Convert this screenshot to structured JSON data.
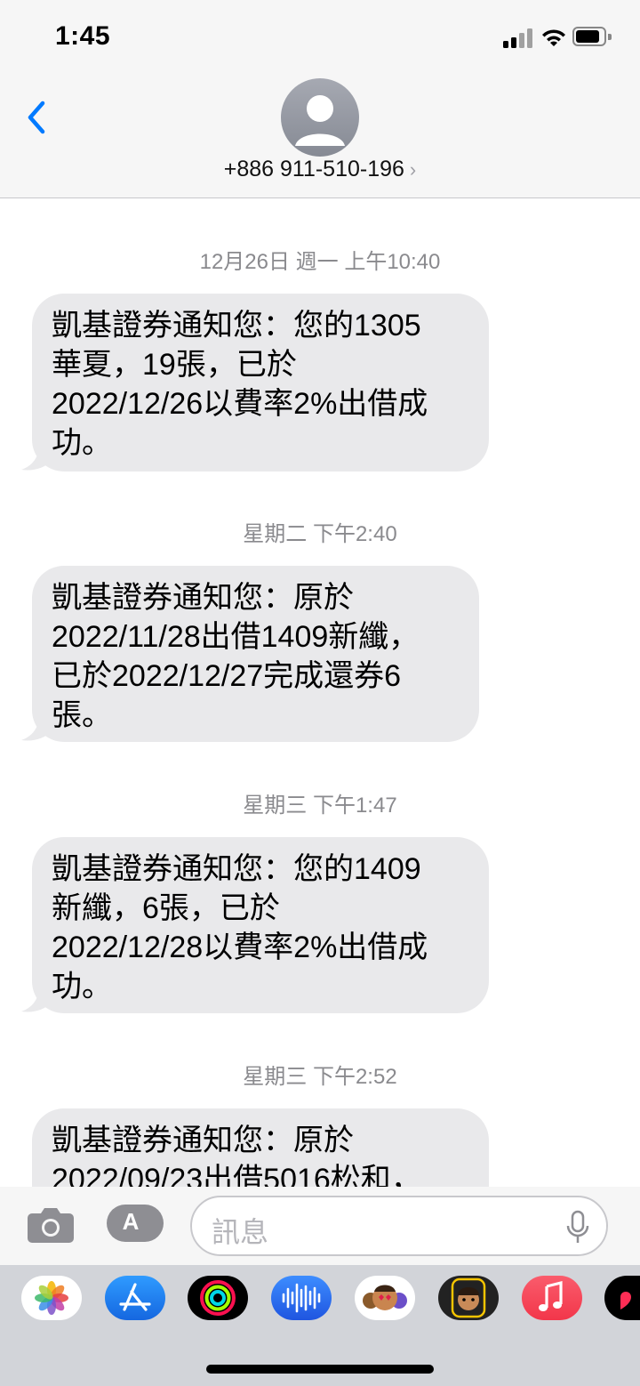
{
  "status": {
    "time": "1:45"
  },
  "header": {
    "contact": "+886 911-510-196",
    "chevron": "›"
  },
  "messages": [
    {
      "timestamp": "12月26日 週一 上午10:40",
      "text": "凱基證券通知您：您的1305\n華夏，19張，已於\n2022/12/26以費率2%出借成\n功。"
    },
    {
      "timestamp": "星期二 下午2:40",
      "text": "凱基證券通知您：原於\n2022/11/28出借1409新纖，\n已於2022/12/27完成還券6\n張。"
    },
    {
      "timestamp": "星期三 下午1:47",
      "text": "凱基證券通知您：您的1409\n新纖，6張，已於\n2022/12/28以費率2%出借成\n功。"
    },
    {
      "timestamp": "星期三 下午2:52",
      "text": "凱基證券通知您：原於\n2022/09/23出借5016松和，"
    }
  ],
  "compose": {
    "placeholder": "訊息",
    "app_button_icon": "A"
  },
  "tray": {
    "apps": [
      "photos-icon",
      "app-store-icon",
      "activity-icon",
      "audio-message-icon",
      "animoji-icon",
      "memoji-icon",
      "music-icon",
      "digital-touch-icon"
    ]
  },
  "colors": {
    "accent": "#007aff",
    "bubble": "#e9e9eb",
    "bar": "#f6f6f6",
    "tray": "#d2d4d9"
  }
}
